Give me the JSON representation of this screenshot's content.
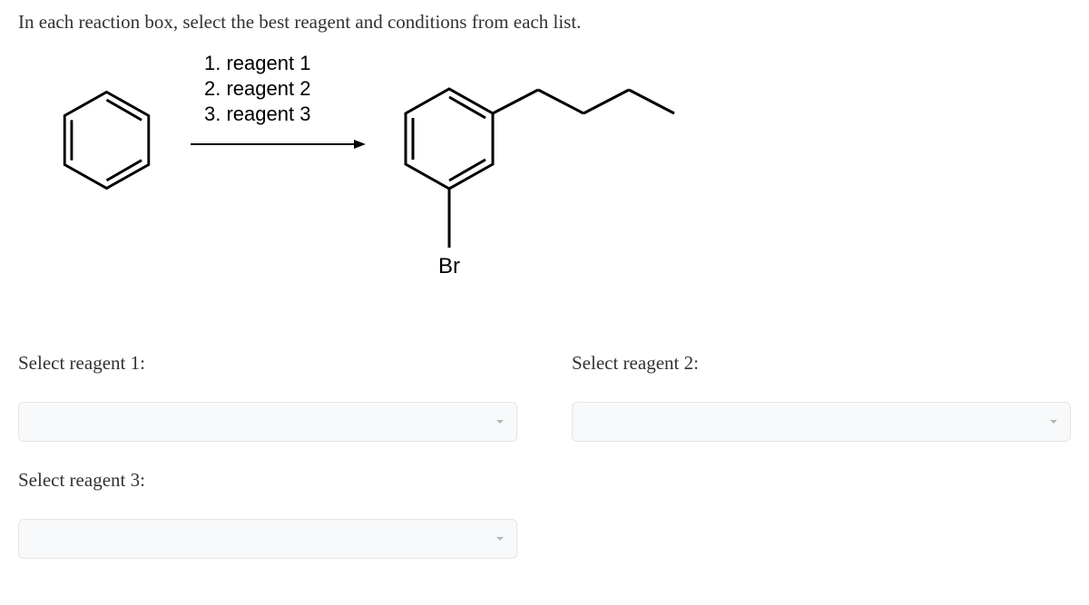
{
  "instruction": "In each reaction box, select the best reagent and conditions from each list.",
  "reagents": {
    "line1": "1. reagent 1",
    "line2": "2. reagent 2",
    "line3": "3. reagent 3"
  },
  "product_label": "Br",
  "selectors": {
    "reagent1": {
      "label": "Select reagent 1:",
      "value": ""
    },
    "reagent2": {
      "label": "Select reagent 2:",
      "value": ""
    },
    "reagent3": {
      "label": "Select reagent 3:",
      "value": ""
    }
  }
}
